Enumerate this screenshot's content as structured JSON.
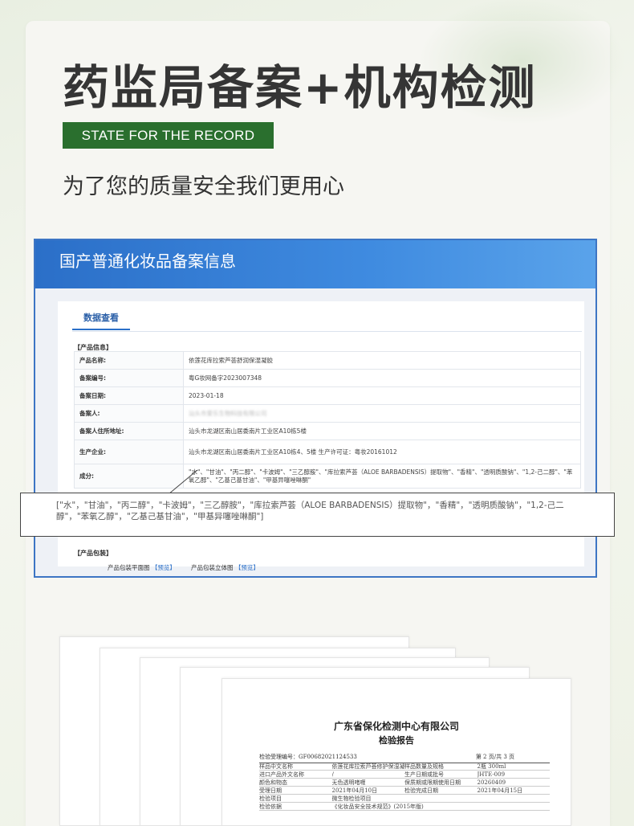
{
  "header": {
    "headline": "药监局备案+机构检测",
    "tag": "STATE FOR THE RECORD",
    "subline": "为了您的质量安全我们更用心"
  },
  "record": {
    "title": "国产普通化妆品备案信息",
    "tab": "数据查看",
    "section_product": "【产品信息】",
    "rows": [
      {
        "key": "产品名称:",
        "value": "依莲花库拉索芦荟舒润保湿凝胶"
      },
      {
        "key": "备案编号:",
        "value": "粤G妆网备字2023007348"
      },
      {
        "key": "备案日期:",
        "value": "2023-01-18"
      },
      {
        "key": "备案人:",
        "value": "汕头市爱乐生物科技有限公司"
      },
      {
        "key": "备案人住所地址:",
        "value": "汕头市龙湖区南山居委南片工业区A10栋5楼"
      },
      {
        "key": "生产企业:",
        "value": "汕头市龙湖区南山居委南片工业区A10栋4、5楼 生产许可证：粤妆20161012"
      },
      {
        "key": "成分:",
        "value": "\"水\"、\"甘油\"、\"丙二醇\"、\"卡波姆\"、\"三乙醇胺\"、\"库拉索芦荟（ALOE BARBADENSIS）提取物\"、\"香精\"、\"透明质酸钠\"、\"1,2-己二醇\"、\"苯氧乙醇\"、\"乙基己基甘油\"、\"甲基异噻唑啉酮\""
      }
    ],
    "section_pack": "【产品包装】",
    "pack_flat": "产品包装平面图",
    "pack_3d": "产品包装立体图",
    "preview": "【预览】",
    "callout": "[\"水\"，\"甘油\"，\"丙二醇\"，\"卡波姆\"，\"三乙醇胺\"，\"库拉索芦荟（ALOE BARBADENSIS）提取物\"，\"香精\"，\"透明质酸钠\"，\"1,2-己二醇\"，\"苯氧乙醇\"，\"乙基己基甘油\"，\"甲基异噻唑啉酮\"]"
  },
  "report": {
    "company": "广东省保化检测中心有限公司",
    "title": "检验报告",
    "number_label": "检验受理编号：GF00682021124533",
    "page": "第 2 页/共 3 页",
    "rows": [
      [
        "样品中文名称",
        "依莲花库拉索芦荟修护保湿凝胶",
        "样品数量及规格",
        "2瓶 300ml"
      ],
      [
        "进口产品外文名称",
        "/",
        "生产日期或批号",
        "JHTE-009"
      ],
      [
        "颜色和物态",
        "无色透明啫喱",
        "保质期或限期使用日期",
        "20260409"
      ],
      [
        "受理日期",
        "2021年04月10日",
        "检验完成日期",
        "2021年04月15日"
      ],
      [
        "检验项目",
        "微生物检验项目",
        "",
        ""
      ],
      [
        "检验依据",
        "《化妆品安全技术规范》(2015年版)",
        "",
        ""
      ]
    ]
  }
}
